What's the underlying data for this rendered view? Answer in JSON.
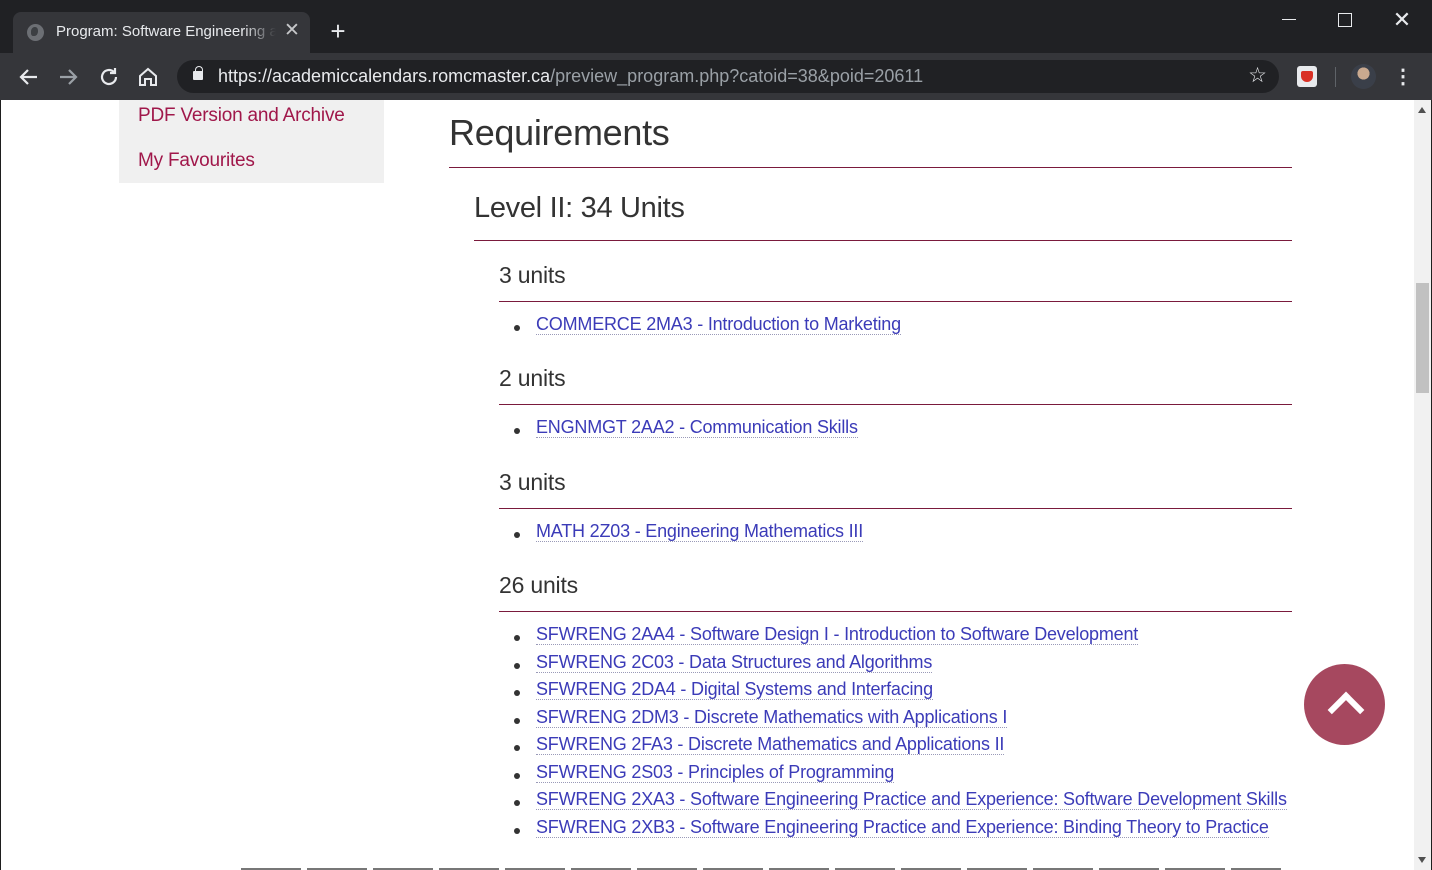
{
  "browser": {
    "tab_title": "Program: Software Engineering and Society",
    "url_host": "https://academiccalendars.romcmaster.ca",
    "url_path": "/preview_program.php?catoid=38&poid=20611",
    "new_tab_glyph": "+",
    "close_glyph": "✕",
    "star_glyph": "☆",
    "menu_glyph": "⋮"
  },
  "sidebar": {
    "items": [
      {
        "label": "PDF Version and Archive"
      },
      {
        "label": "My Favourites"
      }
    ]
  },
  "main": {
    "heading": "Requirements",
    "level": {
      "title": "Level II: 34 Units",
      "groups": [
        {
          "title": "3 units",
          "courses": [
            "COMMERCE 2MA3 - Introduction to Marketing"
          ]
        },
        {
          "title": "2 units",
          "courses": [
            "ENGNMGT 2AA2 - Communication Skills"
          ]
        },
        {
          "title": "3 units",
          "courses": [
            "MATH 2Z03 - Engineering Mathematics III"
          ]
        },
        {
          "title": "26 units",
          "courses": [
            "SFWRENG 2AA4 - Software Design I - Introduction to Software Development",
            "SFWRENG 2C03 - Data Structures and Algorithms",
            "SFWRENG 2DA4 - Digital Systems and Interfacing",
            "SFWRENG 2DM3 - Discrete Mathematics with Applications I",
            "SFWRENG 2FA3 - Discrete Mathematics and Applications II",
            "SFWRENG 2S03 - Principles of Programming",
            "SFWRENG 2XA3 - Software Engineering Practice and Experience: Software Development Skills",
            "SFWRENG 2XB3 - Software Engineering Practice and Experience: Binding Theory to Practice"
          ]
        }
      ]
    }
  },
  "colors": {
    "link": "#3b3bb8",
    "nav_link": "#a0174a",
    "rule": "#7a1a3c",
    "back_to_top": "#a6485f"
  }
}
